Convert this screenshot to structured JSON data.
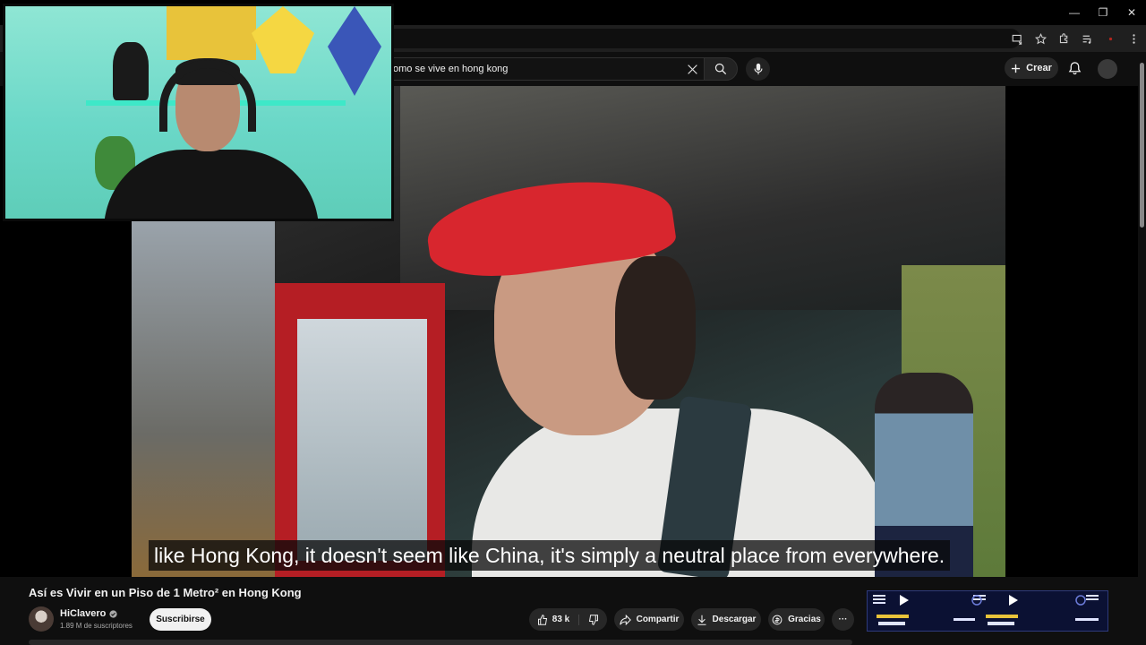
{
  "browser": {
    "window_controls": {
      "minimize": "—",
      "restore": "❐",
      "close": "✕"
    }
  },
  "header": {
    "search": {
      "value": "omo se vive en hong kong"
    },
    "create_label": "Crear"
  },
  "video": {
    "subtitle": "like Hong Kong, it doesn't seem like China, it's simply a neutral place from everywhere.",
    "title": "Así es Vivir en un Piso de 1 Metro² en Hong Kong"
  },
  "channel": {
    "name": "HiClavero",
    "subscribers": "1.89 M de suscriptores",
    "subscribe_label": "Suscribirse"
  },
  "actions": {
    "likes": "83 k",
    "share": "Compartir",
    "download": "Descargar",
    "thanks": "Gracias",
    "more": "···"
  },
  "colors": {
    "background": "#0f0f0f",
    "pill": "#272727",
    "subscribe": "#f1f1f1",
    "webcam_wall": "#6bd8c8",
    "cap_red": "#d8262e"
  }
}
